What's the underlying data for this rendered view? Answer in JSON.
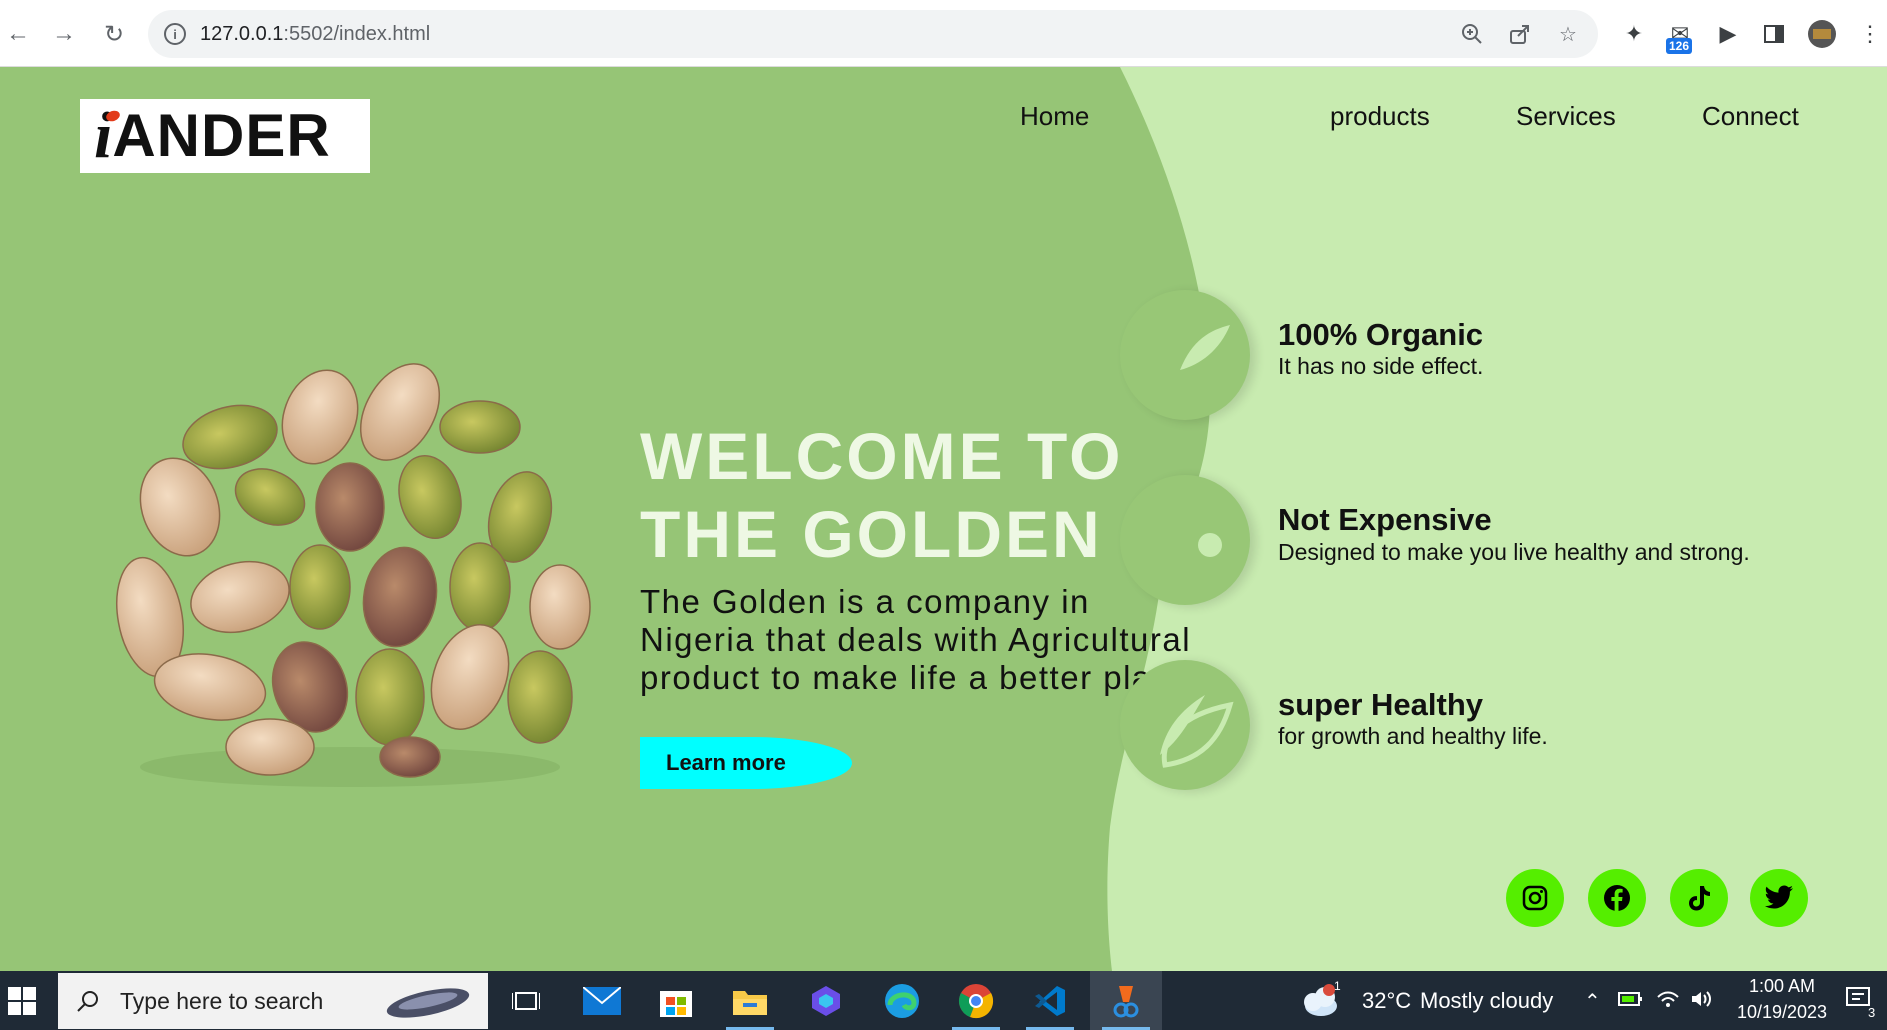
{
  "browser": {
    "url_host": "127.0.0.1",
    "url_path": ":5502/index.html",
    "extension_badge": "126"
  },
  "site": {
    "logo_letter": "i",
    "logo_text": "ANDER",
    "nav": [
      "Home",
      "products",
      "Services",
      "Connect"
    ],
    "hero_title_line1": "WELCOME TO",
    "hero_title_line2": "THE GOLDEN",
    "hero_desc_line1": "The Golden is a company in",
    "hero_desc_line2": "Nigeria that deals with Agricultural",
    "hero_desc_line3": "product to make life a better place",
    "learn_more": "Learn more",
    "features": [
      {
        "title": "100% Organic",
        "subtitle": "It has no side effect.",
        "icon": "leaf-icon"
      },
      {
        "title": "Not Expensive",
        "subtitle": "Designed to make you live healthy and strong.",
        "icon": "tag-icon"
      },
      {
        "title": "super Healthy",
        "subtitle": "for growth and healthy life.",
        "icon": "leaves-icon"
      }
    ],
    "social": [
      "instagram-icon",
      "facebook-icon",
      "tiktok-icon",
      "twitter-icon"
    ],
    "colors": {
      "dark_green": "#96c576",
      "light_green": "#c8ebb0",
      "cta": "#00ffff",
      "social_bg": "#55ee00"
    }
  },
  "taskbar": {
    "search_placeholder": "Type here to search",
    "weather_temp": "32°C",
    "weather_text": "Mostly cloudy",
    "weather_alert_count": "1",
    "time": "1:00 AM",
    "date": "10/19/2023",
    "notification_count": "3"
  }
}
